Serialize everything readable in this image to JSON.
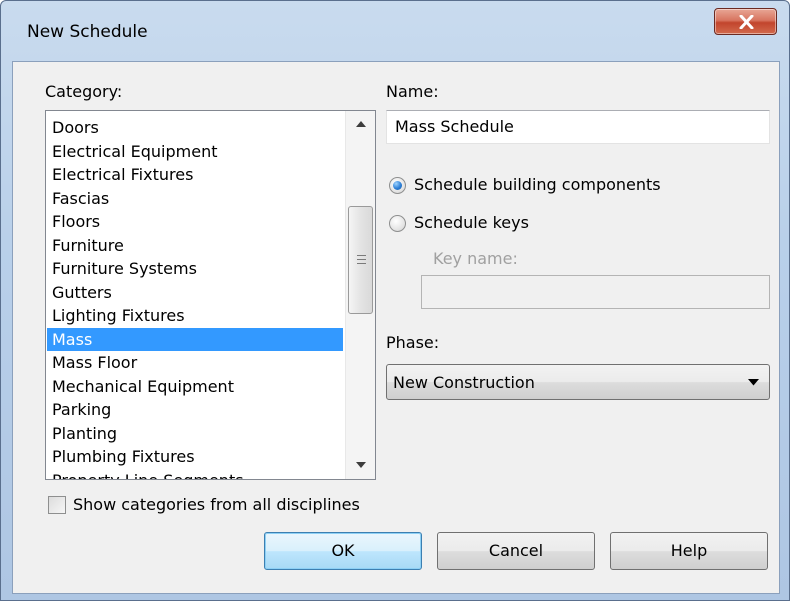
{
  "window": {
    "title": "New Schedule"
  },
  "category": {
    "label": "Category:",
    "items": [
      "Doors",
      "Electrical Equipment",
      "Electrical Fixtures",
      "Fascias",
      "Floors",
      "Furniture",
      "Furniture Systems",
      "Gutters",
      "Lighting Fixtures",
      "Mass",
      "Mass Floor",
      "Mechanical Equipment",
      "Parking",
      "Planting",
      "Plumbing Fixtures",
      "Property Line Segments"
    ],
    "selected": "Mass",
    "show_all_label": "Show categories from all disciplines",
    "show_all_checked": false
  },
  "name": {
    "label": "Name:",
    "value": "Mass Schedule"
  },
  "schedule_type": {
    "option_components": "Schedule building components",
    "option_keys": "Schedule keys",
    "selected": "components",
    "key_name_label": "Key name:",
    "key_name_value": ""
  },
  "phase": {
    "label": "Phase:",
    "value": "New Construction"
  },
  "buttons": {
    "ok": "OK",
    "cancel": "Cancel",
    "help": "Help"
  },
  "colors": {
    "selection": "#3399ff",
    "close_button": "#c2452d"
  }
}
